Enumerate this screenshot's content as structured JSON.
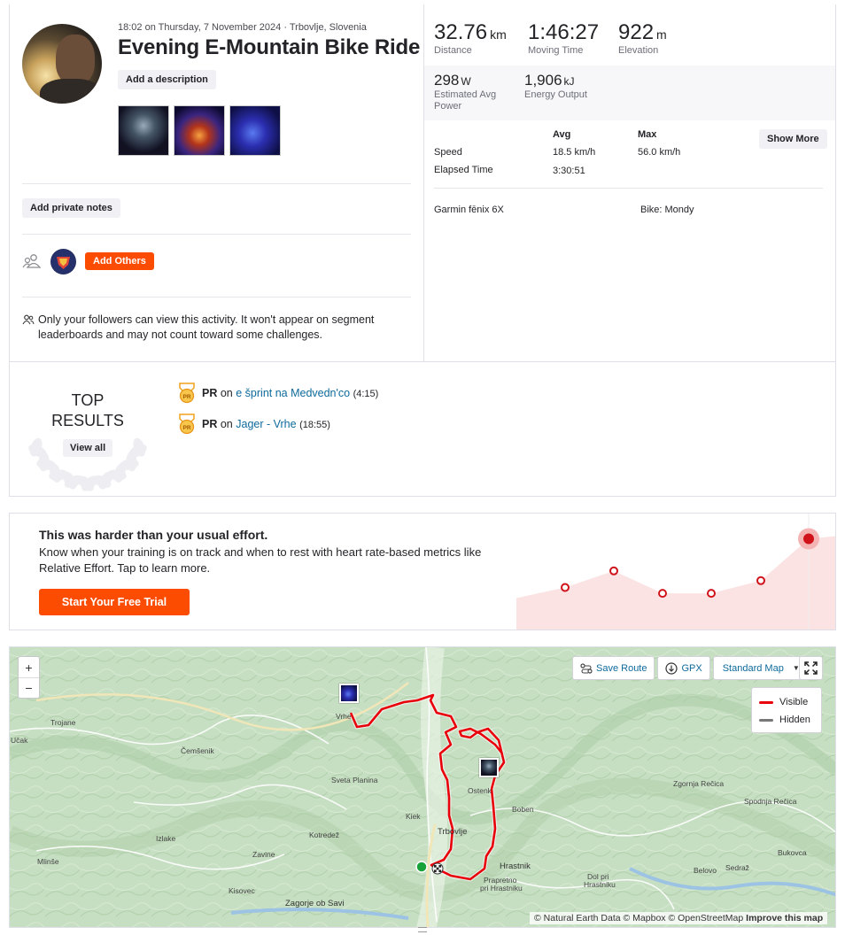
{
  "activity": {
    "meta": "18:02 on Thursday, 7 November 2024 · Trbovlje, Slovenia",
    "title": "Evening E-Mountain Bike Ride",
    "add_description": "Add a description",
    "add_private_notes": "Add private notes",
    "add_others": "Add Others",
    "privacy_notice": "Only your followers can view this activity. It won't appear on segment leaderboards and may not count toward some challenges."
  },
  "stats": {
    "distance": {
      "value": "32.76",
      "unit": "km",
      "label": "Distance"
    },
    "moving_time": {
      "value": "1:46:27",
      "label": "Moving Time"
    },
    "elevation": {
      "value": "922",
      "unit": "m",
      "label": "Elevation"
    },
    "power": {
      "value": "298",
      "unit": "W",
      "label": "Estimated Avg Power"
    },
    "energy": {
      "value": "1,906",
      "unit": "kJ",
      "label": "Energy Output"
    },
    "table": {
      "avg_header": "Avg",
      "max_header": "Max",
      "rows": [
        {
          "label": "Speed",
          "avg": "18.5 km/h",
          "max": "56.0 km/h"
        },
        {
          "label": "Elapsed Time",
          "avg": "3:30:51",
          "max": ""
        }
      ]
    },
    "show_more": "Show More",
    "device": "Garmin fēnix 6X",
    "bike": "Bike: Mondy"
  },
  "top_results": {
    "heading_line1": "TOP",
    "heading_line2": "RESULTS",
    "view_all": "View all",
    "items": [
      {
        "badge": "PR",
        "on": "on",
        "segment": "e šprint na Medvedn'co",
        "time": "(4:15)"
      },
      {
        "badge": "PR",
        "on": "on",
        "segment": "Jager - Vrhe",
        "time": "(18:55)"
      }
    ]
  },
  "upsell": {
    "title": "This was harder than your usual effort.",
    "body": "Know when your training is on track and when to rest with heart rate-based metrics like Relative Effort. Tap to learn more.",
    "cta": "Start Your Free Trial",
    "effort_points": [
      0.25,
      0.42,
      0.19,
      0.19,
      0.32,
      0.75
    ]
  },
  "map": {
    "zoom_in": "+",
    "zoom_out": "−",
    "save_route": "Save Route",
    "gpx": "GPX",
    "map_style": "Standard Map",
    "legend_visible": "Visible",
    "legend_hidden": "Hidden",
    "attribution_sources": "© Natural Earth Data © Mapbox © OpenStreetMap",
    "attribution_link": "Improve this map",
    "places": {
      "trojane": "Trojane",
      "ucak": "Učak",
      "cemsenik": "Čemšenik",
      "vrhe": "Vrhe",
      "sveta_planina": "Sveta Planina",
      "kisovec": "Kisovec",
      "zagorje": "Zagorje ob Savi",
      "izlake": "Izlake",
      "mlinse": "Mlinše",
      "kotredez": "Kotredež",
      "zavine": "Zavine",
      "kiek": "Kiek",
      "trbovlje": "Trbovlje",
      "ostenk": "Ostenk",
      "boben": "Boben",
      "hrastnik": "Hrastnik",
      "prapretno": "Prapretno",
      "pri_hrastniku": "pri Hrastniku",
      "dol_pri": "Dol pri",
      "hrastniku": "Hrastniku",
      "zgornja_recica": "Zgornja Rečica",
      "spodnja_recica": "Spodnja Rečica",
      "bukovca": "Bukovca",
      "belovo": "Belovo",
      "sedraz": "Sedraž"
    }
  },
  "colors": {
    "brand": "#fc4c02",
    "route": "#e8000b",
    "link": "#0e6a9c"
  }
}
